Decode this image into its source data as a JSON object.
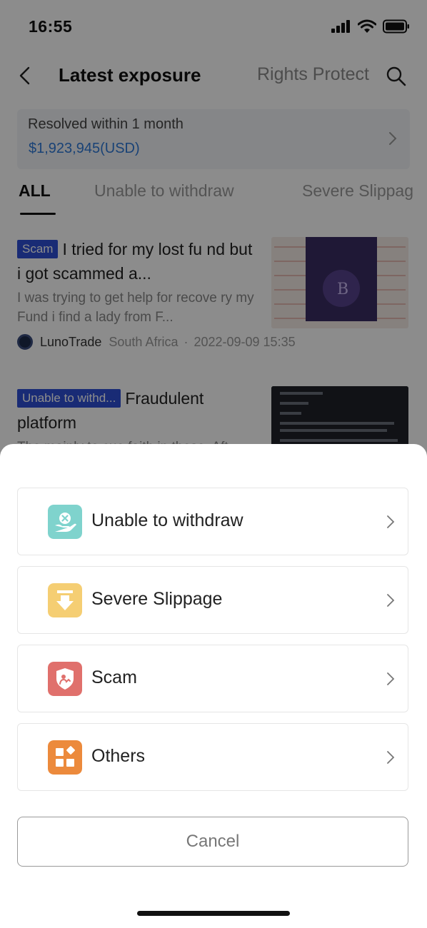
{
  "status_bar": {
    "time": "16:55"
  },
  "nav": {
    "title": "Latest exposure",
    "right_tab": "Rights Protect"
  },
  "summary": {
    "label": "Resolved within 1 month",
    "amount": "$1,923,945(USD)"
  },
  "tabs": [
    "ALL",
    "Unable to withdraw",
    "Severe Slippag"
  ],
  "posts": [
    {
      "tag": "Scam",
      "title": "I tried for my lost fu nd but i got scammed a...",
      "desc": "I was trying to get help for recove ry my Fund i find a lady from F...",
      "broker": "LunoTrade",
      "region": "South Africa",
      "separator": "·",
      "date": "2022-09-09 15:35"
    },
    {
      "tag": "Unable to withd...",
      "title": "Fraudulent platform",
      "desc": "The mainly to cue faith in these. Aft"
    }
  ],
  "sheet": {
    "options": [
      {
        "label": "Unable to withdraw",
        "icon": "withdraw-hand-icon",
        "color": "#7fd3cd"
      },
      {
        "label": "Severe Slippage",
        "icon": "slippage-arrow-icon",
        "color": "#f5ce73"
      },
      {
        "label": "Scam",
        "icon": "scam-shield-icon",
        "color": "#e0706c"
      },
      {
        "label": "Others",
        "icon": "others-grid-icon",
        "color": "#ec8a3c"
      }
    ],
    "cancel": "Cancel"
  }
}
